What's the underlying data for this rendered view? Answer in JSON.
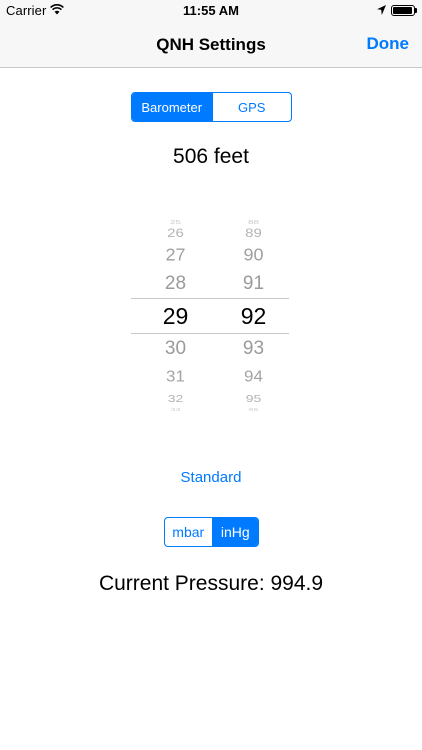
{
  "status_bar": {
    "carrier": "Carrier",
    "time": "11:55 AM",
    "icons": [
      "wifi-icon",
      "location-arrow-icon",
      "battery-icon"
    ]
  },
  "nav": {
    "title": "QNH Settings",
    "done_label": "Done"
  },
  "source_segment": {
    "options": [
      "Barometer",
      "GPS"
    ],
    "selected": "Barometer"
  },
  "altitude": "506 feet",
  "picker": {
    "left_column": [
      "25",
      "26",
      "27",
      "28",
      "29",
      "30",
      "31",
      "32",
      "33"
    ],
    "right_column": [
      "88",
      "89",
      "90",
      "91",
      "92",
      "93",
      "94",
      "95",
      "96"
    ],
    "selected": [
      "29",
      "92"
    ]
  },
  "standard_label": "Standard",
  "unit_segment": {
    "options": [
      "mbar",
      "inHg"
    ],
    "selected": "inHg"
  },
  "current_pressure": "Current Pressure: 994.9",
  "colors": {
    "accent": "#007aff",
    "bar_background": "#f7f7f7",
    "separator": "#c8c7cc"
  }
}
